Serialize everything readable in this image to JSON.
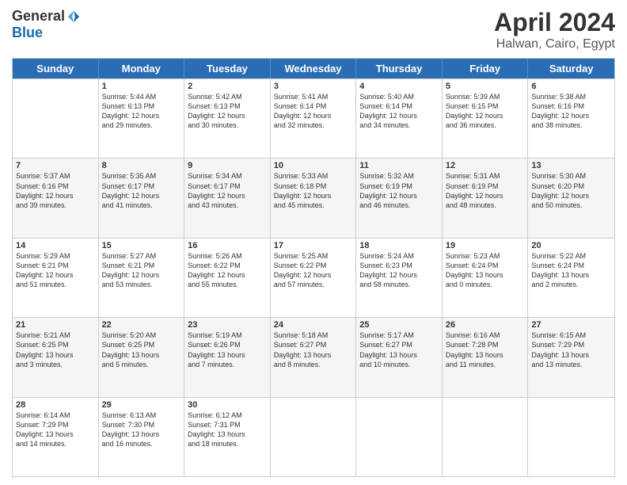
{
  "logo": {
    "general": "General",
    "blue": "Blue"
  },
  "title": "April 2024",
  "location": "Halwan, Cairo, Egypt",
  "weekdays": [
    "Sunday",
    "Monday",
    "Tuesday",
    "Wednesday",
    "Thursday",
    "Friday",
    "Saturday"
  ],
  "rows": [
    [
      {
        "day": "",
        "lines": []
      },
      {
        "day": "1",
        "lines": [
          "Sunrise: 5:44 AM",
          "Sunset: 6:13 PM",
          "Daylight: 12 hours",
          "and 29 minutes."
        ]
      },
      {
        "day": "2",
        "lines": [
          "Sunrise: 5:42 AM",
          "Sunset: 6:13 PM",
          "Daylight: 12 hours",
          "and 30 minutes."
        ]
      },
      {
        "day": "3",
        "lines": [
          "Sunrise: 5:41 AM",
          "Sunset: 6:14 PM",
          "Daylight: 12 hours",
          "and 32 minutes."
        ]
      },
      {
        "day": "4",
        "lines": [
          "Sunrise: 5:40 AM",
          "Sunset: 6:14 PM",
          "Daylight: 12 hours",
          "and 34 minutes."
        ]
      },
      {
        "day": "5",
        "lines": [
          "Sunrise: 5:39 AM",
          "Sunset: 6:15 PM",
          "Daylight: 12 hours",
          "and 36 minutes."
        ]
      },
      {
        "day": "6",
        "lines": [
          "Sunrise: 5:38 AM",
          "Sunset: 6:16 PM",
          "Daylight: 12 hours",
          "and 38 minutes."
        ]
      }
    ],
    [
      {
        "day": "7",
        "lines": [
          "Sunrise: 5:37 AM",
          "Sunset: 6:16 PM",
          "Daylight: 12 hours",
          "and 39 minutes."
        ]
      },
      {
        "day": "8",
        "lines": [
          "Sunrise: 5:35 AM",
          "Sunset: 6:17 PM",
          "Daylight: 12 hours",
          "and 41 minutes."
        ]
      },
      {
        "day": "9",
        "lines": [
          "Sunrise: 5:34 AM",
          "Sunset: 6:17 PM",
          "Daylight: 12 hours",
          "and 43 minutes."
        ]
      },
      {
        "day": "10",
        "lines": [
          "Sunrise: 5:33 AM",
          "Sunset: 6:18 PM",
          "Daylight: 12 hours",
          "and 45 minutes."
        ]
      },
      {
        "day": "11",
        "lines": [
          "Sunrise: 5:32 AM",
          "Sunset: 6:19 PM",
          "Daylight: 12 hours",
          "and 46 minutes."
        ]
      },
      {
        "day": "12",
        "lines": [
          "Sunrise: 5:31 AM",
          "Sunset: 6:19 PM",
          "Daylight: 12 hours",
          "and 48 minutes."
        ]
      },
      {
        "day": "13",
        "lines": [
          "Sunrise: 5:30 AM",
          "Sunset: 6:20 PM",
          "Daylight: 12 hours",
          "and 50 minutes."
        ]
      }
    ],
    [
      {
        "day": "14",
        "lines": [
          "Sunrise: 5:29 AM",
          "Sunset: 6:21 PM",
          "Daylight: 12 hours",
          "and 51 minutes."
        ]
      },
      {
        "day": "15",
        "lines": [
          "Sunrise: 5:27 AM",
          "Sunset: 6:21 PM",
          "Daylight: 12 hours",
          "and 53 minutes."
        ]
      },
      {
        "day": "16",
        "lines": [
          "Sunrise: 5:26 AM",
          "Sunset: 6:22 PM",
          "Daylight: 12 hours",
          "and 55 minutes."
        ]
      },
      {
        "day": "17",
        "lines": [
          "Sunrise: 5:25 AM",
          "Sunset: 6:22 PM",
          "Daylight: 12 hours",
          "and 57 minutes."
        ]
      },
      {
        "day": "18",
        "lines": [
          "Sunrise: 5:24 AM",
          "Sunset: 6:23 PM",
          "Daylight: 12 hours",
          "and 58 minutes."
        ]
      },
      {
        "day": "19",
        "lines": [
          "Sunrise: 5:23 AM",
          "Sunset: 6:24 PM",
          "Daylight: 13 hours",
          "and 0 minutes."
        ]
      },
      {
        "day": "20",
        "lines": [
          "Sunrise: 5:22 AM",
          "Sunset: 6:24 PM",
          "Daylight: 13 hours",
          "and 2 minutes."
        ]
      }
    ],
    [
      {
        "day": "21",
        "lines": [
          "Sunrise: 5:21 AM",
          "Sunset: 6:25 PM",
          "Daylight: 13 hours",
          "and 3 minutes."
        ]
      },
      {
        "day": "22",
        "lines": [
          "Sunrise: 5:20 AM",
          "Sunset: 6:25 PM",
          "Daylight: 13 hours",
          "and 5 minutes."
        ]
      },
      {
        "day": "23",
        "lines": [
          "Sunrise: 5:19 AM",
          "Sunset: 6:26 PM",
          "Daylight: 13 hours",
          "and 7 minutes."
        ]
      },
      {
        "day": "24",
        "lines": [
          "Sunrise: 5:18 AM",
          "Sunset: 6:27 PM",
          "Daylight: 13 hours",
          "and 8 minutes."
        ]
      },
      {
        "day": "25",
        "lines": [
          "Sunrise: 5:17 AM",
          "Sunset: 6:27 PM",
          "Daylight: 13 hours",
          "and 10 minutes."
        ]
      },
      {
        "day": "26",
        "lines": [
          "Sunrise: 6:16 AM",
          "Sunset: 7:28 PM",
          "Daylight: 13 hours",
          "and 11 minutes."
        ]
      },
      {
        "day": "27",
        "lines": [
          "Sunrise: 6:15 AM",
          "Sunset: 7:29 PM",
          "Daylight: 13 hours",
          "and 13 minutes."
        ]
      }
    ],
    [
      {
        "day": "28",
        "lines": [
          "Sunrise: 6:14 AM",
          "Sunset: 7:29 PM",
          "Daylight: 13 hours",
          "and 14 minutes."
        ]
      },
      {
        "day": "29",
        "lines": [
          "Sunrise: 6:13 AM",
          "Sunset: 7:30 PM",
          "Daylight: 13 hours",
          "and 16 minutes."
        ]
      },
      {
        "day": "30",
        "lines": [
          "Sunrise: 6:12 AM",
          "Sunset: 7:31 PM",
          "Daylight: 13 hours",
          "and 18 minutes."
        ]
      },
      {
        "day": "",
        "lines": []
      },
      {
        "day": "",
        "lines": []
      },
      {
        "day": "",
        "lines": []
      },
      {
        "day": "",
        "lines": []
      }
    ]
  ]
}
